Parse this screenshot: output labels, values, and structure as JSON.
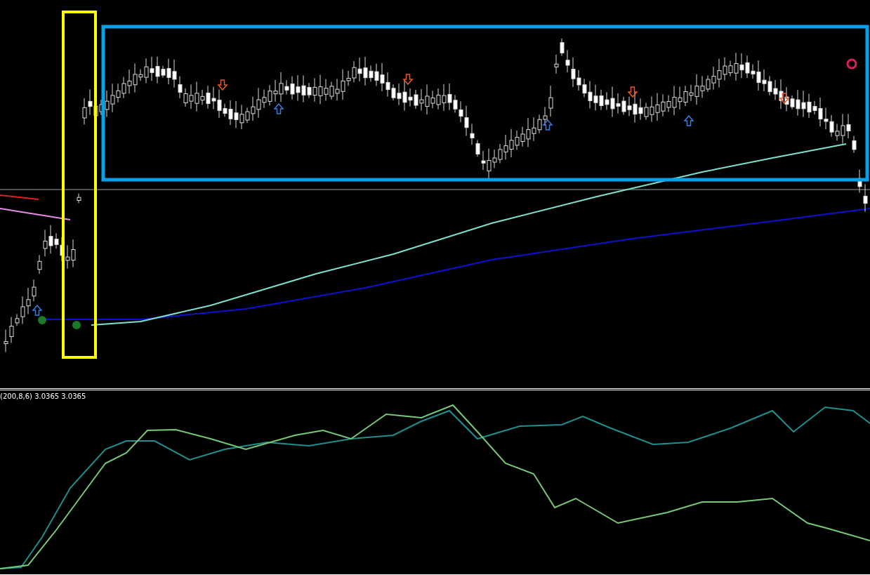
{
  "indicator_panel": {
    "label": "(200,8,6) 3.0365 3.0365"
  }
}
